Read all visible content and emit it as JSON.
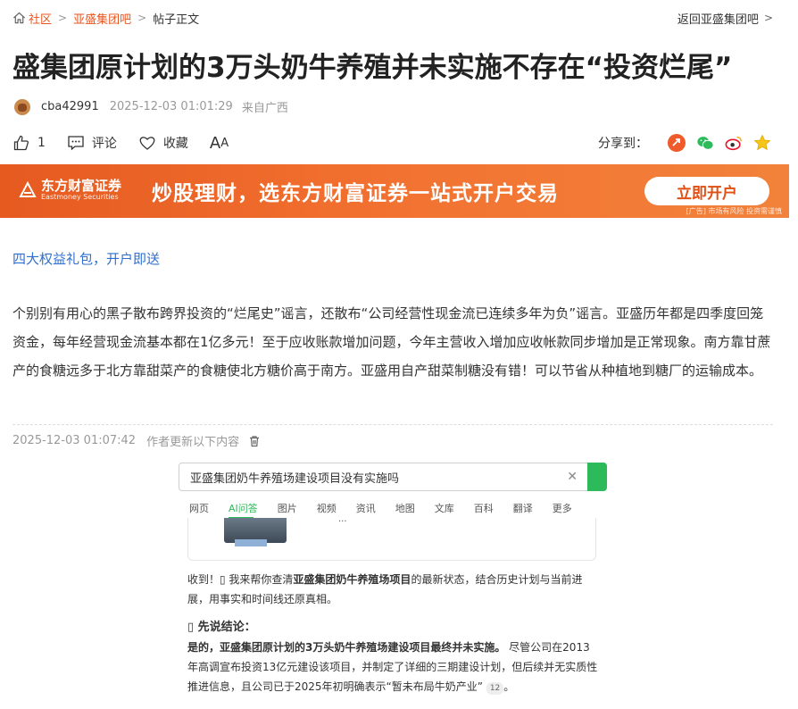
{
  "breadcrumb": {
    "home": "社区",
    "bar": "亚盛集团吧",
    "current": "帖子正文",
    "back": "返回亚盛集团吧"
  },
  "title": "盛集团原计划的3万头奶牛养殖并未实施不存在“投资烂尾”",
  "meta": {
    "author": "cba42991",
    "time": "2025-12-03 01:01:29",
    "location": "来自广西"
  },
  "actions": {
    "like_count": "1",
    "comment": "评论",
    "collect": "收藏",
    "font_big": "A",
    "font_small": "A",
    "share_label": "分享到："
  },
  "banner": {
    "brand": "东方财富证券",
    "brand_en": "Eastmoney Securities",
    "slogan": "炒股理财，选东方财富证券一站式开户交易",
    "button": "立即开户",
    "note": "[广告] 市场有风险 投资需谨慎"
  },
  "promo_link": "四大权益礼包，开户即送",
  "body": "个别别有用心的黑子散布跨界投资的“烂尾史”谣言，还散布“公司经营性现金流已连续多年为负”谣言。亚盛历年都是四季度回笼资金，每年经营现金流基本都在1亿多元！至于应收账款增加问题，今年主营收入增加应收帐款同步增加是正常现象。南方靠甘蔗产的食糖远多于北方靠甜菜产的食糖使北方糖价高于南方。亚盛用自产甜菜制糖没有错！可以节省从种植地到糖厂的运输成本。",
  "update": {
    "time": "2025-12-03 01:07:42",
    "label": "作者更新以下内容"
  },
  "screenshot": {
    "query": "亚盛集团奶牛养殖场建设项目没有实施吗",
    "tabs": [
      "网页",
      "AI问答",
      "图片",
      "视频",
      "资讯",
      "地图",
      "文库",
      "百科",
      "翻译",
      "更多"
    ],
    "card_text": "...",
    "intro_a": "收到！▯ 我来帮你查清",
    "intro_b": "亚盛集团奶牛养殖场项目",
    "intro_c": "的最新状态，结合历史计划与当前进展，用事实和时间线还原真相。",
    "heading": "▯ 先说结论：",
    "conclusion_bold": "是的，亚盛集团原计划的3万头奶牛养殖场建设项目最终并未实施。",
    "conclusion_rest": " 尽管公司在2013年高调宣布投资13亿元建设该项目，并制定了详细的三期建设计划，但后续并无实质性推进信息，且公司已于2025年初明确表示“暂未布局牛奶产业”",
    "ref": "12",
    "end": "。"
  },
  "colors": {
    "accent": "#e8541e",
    "link": "#2f6fcf",
    "banner": "#f27231",
    "search_green": "#2dba5b"
  }
}
